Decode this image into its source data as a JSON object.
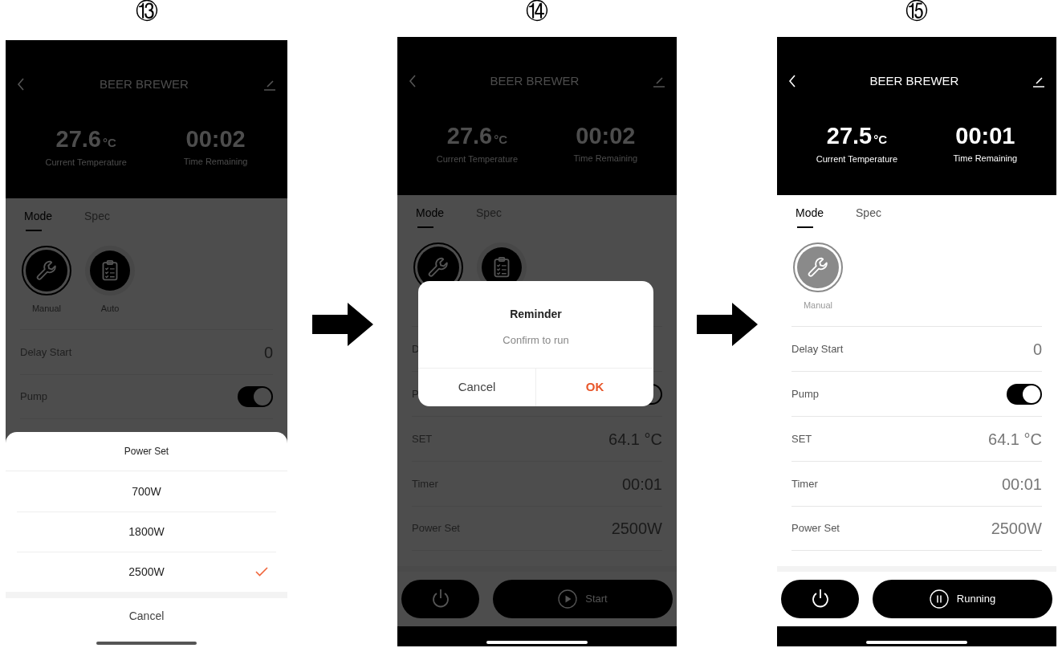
{
  "screens": [
    {
      "step": "⑬",
      "title": "BEER BREWER",
      "dimmed": true,
      "running": false,
      "stats": [
        {
          "value": "27.6",
          "unit": "°C",
          "label": "Current Temperature"
        },
        {
          "value": "00:02",
          "label": "Time Remaining"
        }
      ],
      "tabs": [
        {
          "label": "Mode",
          "selected": true
        },
        {
          "label": "Spec",
          "selected": false
        }
      ],
      "modes": [
        {
          "kind": "manual",
          "label": "Manual",
          "selected": true
        },
        {
          "kind": "auto",
          "label": "Auto",
          "selected": false
        }
      ],
      "rows": [
        {
          "kind": "value",
          "label": "Delay Start",
          "value": "0"
        },
        {
          "kind": "toggle",
          "label": "Pump",
          "on": true
        }
      ],
      "sheet": {
        "title": "Power Set",
        "options": [
          {
            "label": "700W",
            "selected": false
          },
          {
            "label": "1800W",
            "selected": false
          },
          {
            "label": "2500W",
            "selected": true
          }
        ],
        "cancel": "Cancel"
      }
    },
    {
      "step": "⑭",
      "title": "BEER BREWER",
      "dimmed": true,
      "running": false,
      "stats": [
        {
          "value": "27.6",
          "unit": "°C",
          "label": "Current Temperature"
        },
        {
          "value": "00:02",
          "label": "Time Remaining"
        }
      ],
      "tabs": [
        {
          "label": "Mode",
          "selected": true
        },
        {
          "label": "Spec",
          "selected": false
        }
      ],
      "modes": [
        {
          "kind": "manual",
          "selected": true
        },
        {
          "kind": "auto",
          "selected": false
        }
      ],
      "rows": [
        {
          "kind": "value",
          "label": "D"
        },
        {
          "kind": "toggle",
          "label": "P",
          "on": true
        },
        {
          "kind": "value",
          "label": "SET",
          "value": "64.1 °C"
        },
        {
          "kind": "value",
          "label": "Timer",
          "value": "00:01"
        },
        {
          "kind": "value",
          "label": "Power Set",
          "value": "2500W"
        }
      ],
      "actions": {
        "kind": "play",
        "label": "Start"
      },
      "dialog": {
        "title": "Reminder",
        "message": "Confirm to run",
        "cancel": "Cancel",
        "ok": "OK"
      }
    },
    {
      "step": "⑮",
      "title": "BEER BREWER",
      "dimmed": false,
      "running": true,
      "stats": [
        {
          "value": "27.5",
          "unit": "°C",
          "label": "Current Temperature"
        },
        {
          "value": "00:01",
          "label": "Time Remaining"
        }
      ],
      "tabs": [
        {
          "label": "Mode",
          "selected": true
        },
        {
          "label": "Spec",
          "selected": false
        }
      ],
      "modes": [
        {
          "kind": "manual",
          "label": "Manual",
          "selected": true
        }
      ],
      "rows": [
        {
          "kind": "value",
          "label": "Delay Start",
          "value": "0"
        },
        {
          "kind": "toggle",
          "label": "Pump",
          "on": true
        },
        {
          "kind": "value",
          "label": "SET",
          "value": "64.1 °C"
        },
        {
          "kind": "value",
          "label": "Timer",
          "value": "00:01"
        },
        {
          "kind": "value",
          "label": "Power Set",
          "value": "2500W"
        }
      ],
      "actions": {
        "kind": "pause",
        "label": "Running"
      }
    }
  ]
}
